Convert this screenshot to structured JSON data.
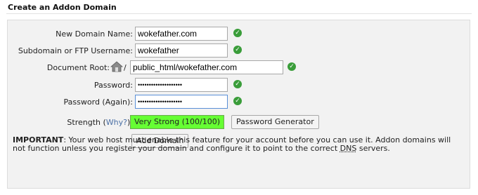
{
  "section": {
    "title": "Create an Addon Domain"
  },
  "form": {
    "new_domain": {
      "label": "New Domain Name:",
      "value": "wokefather.com"
    },
    "subdomain": {
      "label": "Subdomain or FTP Username:",
      "value": "wokefather"
    },
    "docroot": {
      "label": "Document Root:",
      "slash": "/",
      "value": "public_html/wokefather.com"
    },
    "password": {
      "label": "Password:",
      "value": "••••••••••••••••••••"
    },
    "password_again": {
      "label": "Password (Again):",
      "value": "••••••••••••••••••••"
    },
    "strength": {
      "label": "Strength",
      "why_open": "(",
      "why": "Why?",
      "why_close": "):",
      "value_text": "Very Strong (100/100)",
      "value_percent": 100,
      "color": "#66ff33"
    },
    "generator_button": "Password Generator",
    "add_button": "Add Domain"
  },
  "validation_icon": "check-circle-icon",
  "docroot_icon": "home-icon",
  "important": {
    "lead": "IMPORTANT",
    "text_before_dns": ": Your web host must enable this feature for your account before you can use it. Addon domains will not function unless you register your domain and configure it to point to the correct ",
    "dns": "DNS",
    "text_after_dns": " servers."
  }
}
